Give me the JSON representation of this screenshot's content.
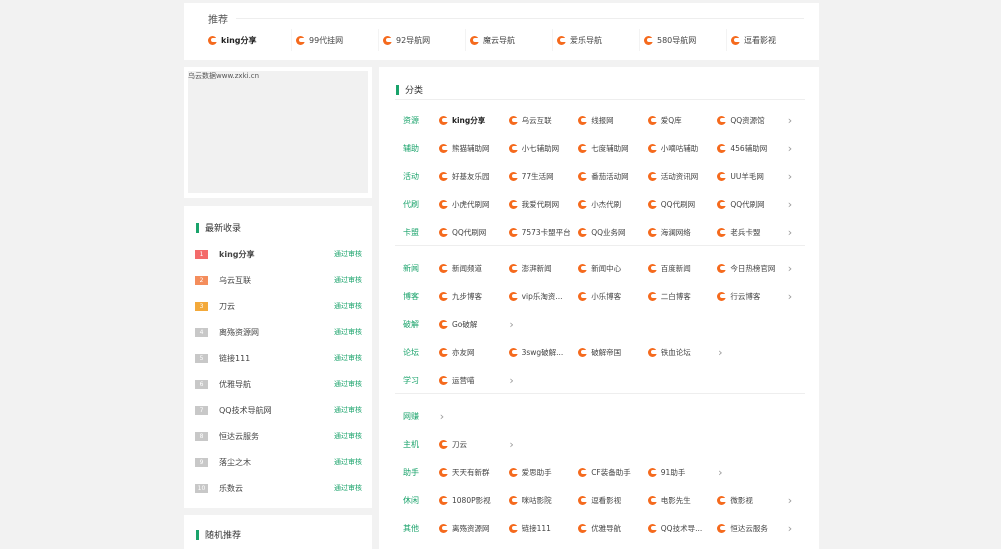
{
  "recommend": {
    "title": "推荐",
    "items": [
      {
        "label": "king分享",
        "bold": true
      },
      {
        "label": "99代挂网",
        "bold": false
      },
      {
        "label": "92导航网",
        "bold": false
      },
      {
        "label": "魔云导航",
        "bold": false
      },
      {
        "label": "爱乐导航",
        "bold": false
      },
      {
        "label": "580导航网",
        "bold": false
      },
      {
        "label": "逗看影视",
        "bold": false
      }
    ]
  },
  "ad": {
    "alt": "乌云数据www.zxki.cn"
  },
  "latest": {
    "title": "最新收录",
    "items": [
      {
        "rank": "1",
        "name": "king分享",
        "status": "通过审核",
        "bold": true
      },
      {
        "rank": "2",
        "name": "乌云互联",
        "status": "通过审核",
        "bold": false
      },
      {
        "rank": "3",
        "name": "刀云",
        "status": "通过审核",
        "bold": false
      },
      {
        "rank": "4",
        "name": "离殇资源网",
        "status": "通过审核",
        "bold": false
      },
      {
        "rank": "5",
        "name": "链接111",
        "status": "通过审核",
        "bold": false
      },
      {
        "rank": "6",
        "name": "优雅导航",
        "status": "通过审核",
        "bold": false
      },
      {
        "rank": "7",
        "name": "QQ技术导航网",
        "status": "通过审核",
        "bold": false
      },
      {
        "rank": "8",
        "name": "恒达云服务",
        "status": "通过审核",
        "bold": false
      },
      {
        "rank": "9",
        "name": "落尘之木",
        "status": "通过审核",
        "bold": false
      },
      {
        "rank": "10",
        "name": "乐数云",
        "status": "通过审核",
        "bold": false
      }
    ]
  },
  "random": {
    "title": "随机推荐"
  },
  "categories": {
    "title": "分类",
    "more_symbol": "›",
    "rows": [
      {
        "name": "资源",
        "items": [
          "king分享",
          "乌云互联",
          "线报网",
          "爱Q库",
          "QQ资源馆"
        ],
        "more": true,
        "boldFirst": true
      },
      {
        "name": "辅助",
        "items": [
          "熊猫辅助网",
          "小七辅助网",
          "七度辅助网",
          "小嘀咕辅助",
          "456辅助网"
        ],
        "more": true
      },
      {
        "name": "活动",
        "items": [
          "好基友乐园",
          "77生活网",
          "番茄活动网",
          "活动资讯网",
          "UU羊毛网"
        ],
        "more": true
      },
      {
        "name": "代刷",
        "items": [
          "小虎代刷网",
          "我爱代刷网",
          "小杰代刷",
          "QQ代刷网",
          "QQ代刷网"
        ],
        "more": true
      },
      {
        "name": "卡盟",
        "items": [
          "QQ代刷网",
          "7573卡盟平台",
          "QQ业务网",
          "海澜网络",
          "老兵卡盟"
        ],
        "more": true
      },
      {
        "name": "新闻",
        "items": [
          "新闻频道",
          "澎湃新闻",
          "新闻中心",
          "百度新闻",
          "今日热榜官网"
        ],
        "more": true
      },
      {
        "name": "博客",
        "items": [
          "九步博客",
          "vip乐淘资...",
          "小乐博客",
          "二白博客",
          "行云博客"
        ],
        "more": true
      },
      {
        "name": "破解",
        "items": [
          "Go破解"
        ],
        "more": true
      },
      {
        "name": "论坛",
        "items": [
          "亦友网",
          "3swg破解...",
          "破解帝国",
          "铁血论坛"
        ],
        "more": true
      },
      {
        "name": "学习",
        "items": [
          "运营喵"
        ],
        "more": true
      },
      {
        "name": "网赚",
        "items": [],
        "more": true
      },
      {
        "name": "主机",
        "items": [
          "刀云"
        ],
        "more": true
      },
      {
        "name": "助手",
        "items": [
          "天天有新群",
          "爱思助手",
          "CF装备助手",
          "91助手"
        ],
        "more": true
      },
      {
        "name": "休闲",
        "items": [
          "1080P影视",
          "咪咕影院",
          "逗看影视",
          "电影先生",
          "微影视"
        ],
        "more": true
      },
      {
        "name": "其他",
        "items": [
          "离殇资源网",
          "链接111",
          "优雅导航",
          "QQ技术导...",
          "恒达云服务"
        ],
        "more": true
      }
    ]
  }
}
